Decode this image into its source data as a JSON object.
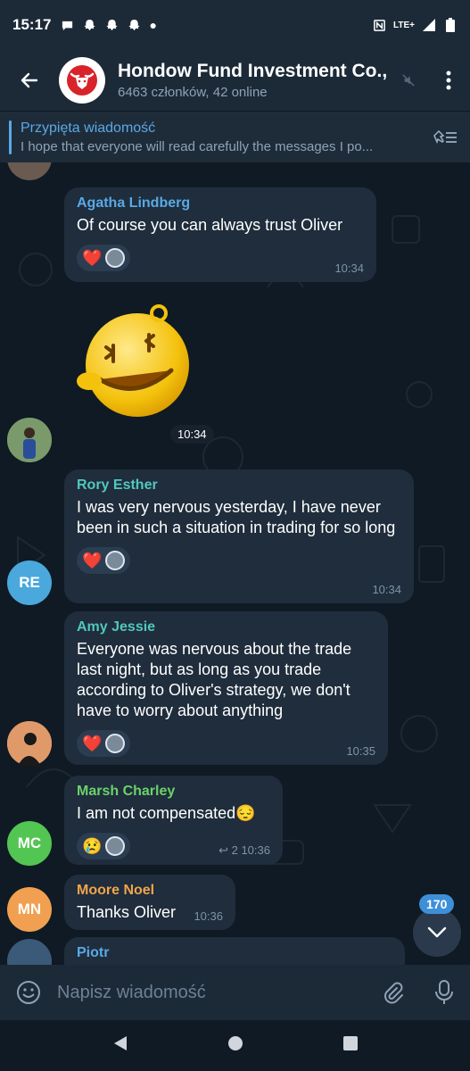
{
  "status_bar": {
    "time": "15:17",
    "network": "LTE+"
  },
  "header": {
    "title": "Hondow Fund Investment Co.,",
    "subtitle": "6463 członków, 42 online"
  },
  "pinned": {
    "label": "Przypięta wiadomość",
    "text": "I hope that everyone will read carefully the messages I po..."
  },
  "messages": [
    {
      "sender": "Agatha Lindberg",
      "sender_color": "#5aa9e6",
      "text": "Of course you can always trust Oliver",
      "time": "10:34",
      "reaction": "❤️"
    },
    {
      "type": "sticker",
      "time": "10:34"
    },
    {
      "sender": "Rory Esther",
      "sender_color": "#52c7bd",
      "avatar_initials": "RE",
      "avatar_color": "#4aa8dc",
      "text": "I was very nervous yesterday, I have never been in such a situation in trading for so long",
      "time": "10:34",
      "reaction": "❤️"
    },
    {
      "sender": "Amy Jessie",
      "sender_color": "#52c7bd",
      "text": "Everyone was nervous about the trade last night, but as long as you trade according to Oliver's strategy, we don't have to worry about anything",
      "time": "10:35",
      "reaction": "❤️"
    },
    {
      "sender": "Marsh Charley",
      "sender_color": "#6bd26b",
      "avatar_initials": "MC",
      "avatar_color": "#53c552",
      "text": "I am not compensated😔",
      "time": "10:36",
      "replies": "2",
      "reaction": "😢"
    },
    {
      "sender": "Moore Noel",
      "sender_color": "#f2a54a",
      "avatar_initials": "MN",
      "avatar_color": "#f0a050",
      "text": "Thanks Oliver",
      "time": "10:36"
    },
    {
      "sender": "Piotr",
      "sender_color": "#5aa9e6"
    }
  ],
  "unread_count": "170",
  "composer": {
    "placeholder": "Napisz wiadomość"
  }
}
